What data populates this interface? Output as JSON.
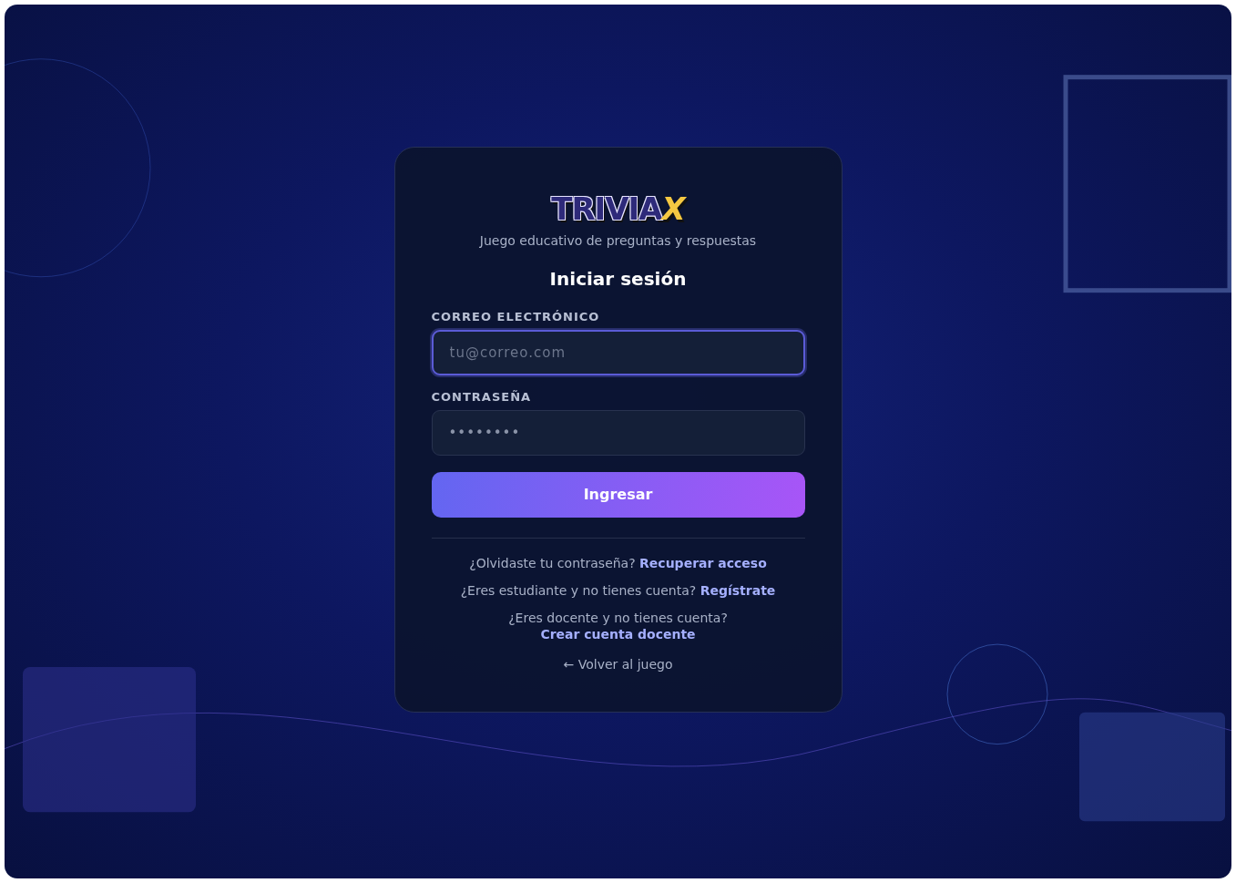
{
  "logo": {
    "main": "TRIVIA",
    "accent": "X"
  },
  "tagline": "Juego educativo de preguntas y respuestas",
  "heading": "Iniciar sesión",
  "fields": [
    {
      "label": "CORREO ELECTRÓNICO",
      "placeholder": "tu@correo.com",
      "focused": true
    },
    {
      "label": "CONTRASEÑA",
      "value": "••••••••",
      "focused": false
    }
  ],
  "submit": "Ingresar",
  "prompts": [
    {
      "text": "¿Olvidaste tu contraseña?",
      "link": "Recuperar acceso"
    },
    {
      "text": "¿Eres estudiante y no tienes cuenta?",
      "link": "Regístrate"
    },
    {
      "text": "¿Eres docente y no tienes cuenta?",
      "link": "Crear cuenta docente"
    }
  ],
  "back_link": "← Volver al juego"
}
